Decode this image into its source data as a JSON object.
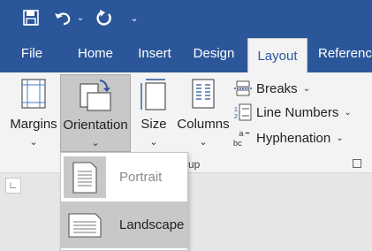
{
  "qat": {
    "icons": [
      "save-icon",
      "undo-icon",
      "undo-dropdown-icon",
      "redo-icon",
      "customize-qat-icon"
    ]
  },
  "tabs": [
    {
      "label": "File"
    },
    {
      "label": "Home"
    },
    {
      "label": "Insert"
    },
    {
      "label": "Design"
    },
    {
      "label": "Layout"
    },
    {
      "label": "Referenc"
    }
  ],
  "active_tab": "Layout",
  "ribbon": {
    "margins_label": "Margins",
    "orientation_label": "Orientation",
    "size_label": "Size",
    "columns_label": "Columns",
    "breaks_label": "Breaks",
    "line_numbers_label": "Line Numbers",
    "hyphenation_label": "Hyphenation",
    "group_label_partial": "up"
  },
  "orientation_menu": {
    "items": [
      {
        "label": "Portrait"
      },
      {
        "label": "Landscape"
      }
    ],
    "selected": "Landscape"
  },
  "colors": {
    "title_bar": "#2b579a",
    "ribbon_bg": "#f3f3f3",
    "pressed_bg": "#c8c8c8",
    "selected_item_bg": "#c8c8c8"
  }
}
